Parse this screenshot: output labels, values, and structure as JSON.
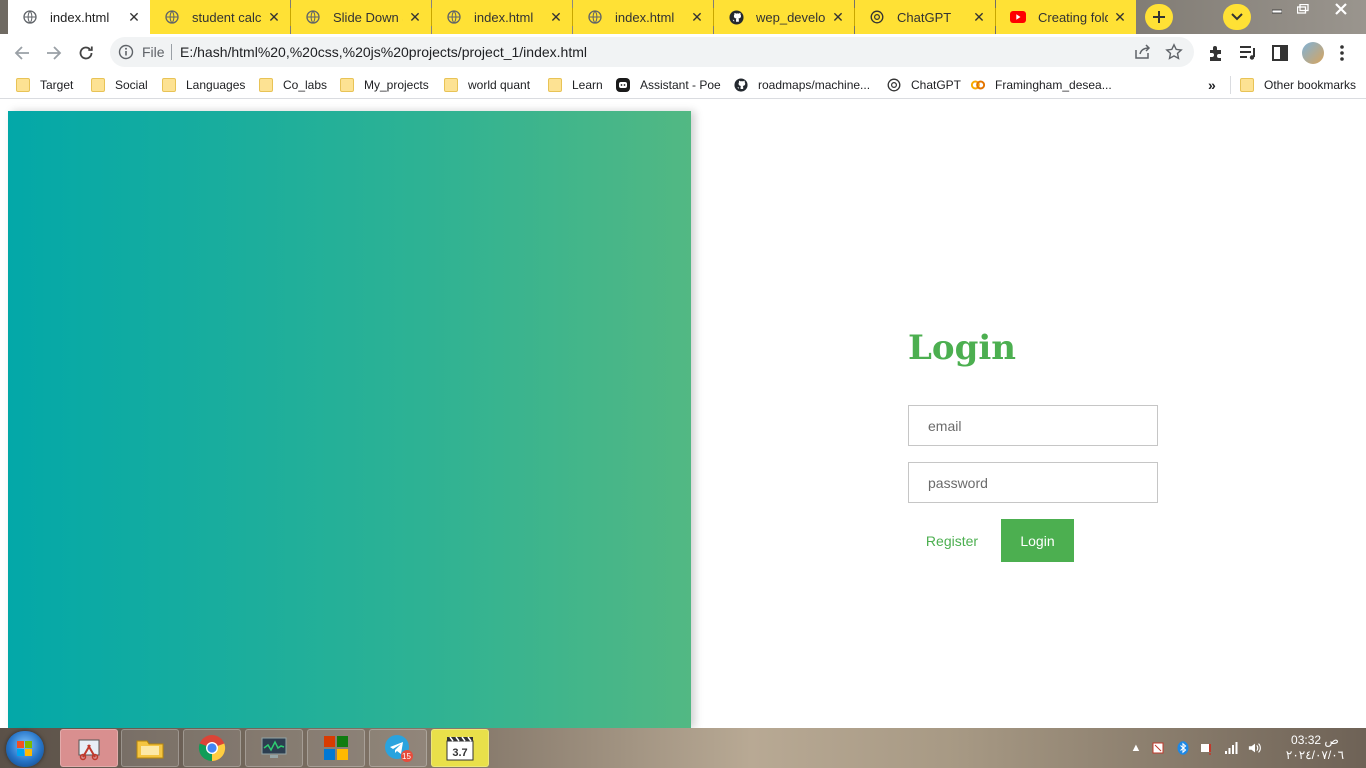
{
  "browser": {
    "tabs": [
      {
        "title": "index.html",
        "icon": "globe-icon",
        "active": true
      },
      {
        "title": "student calcul",
        "icon": "globe-icon",
        "active": false
      },
      {
        "title": "Slide Down a",
        "icon": "globe-icon",
        "active": false
      },
      {
        "title": "index.html",
        "icon": "globe-icon",
        "active": false
      },
      {
        "title": "index.html",
        "icon": "globe-icon",
        "active": false
      },
      {
        "title": "wep_developm",
        "icon": "github-icon",
        "active": false
      },
      {
        "title": "ChatGPT",
        "icon": "chatgpt-icon",
        "active": false
      },
      {
        "title": "Creating folde",
        "icon": "youtube-icon",
        "active": false
      }
    ],
    "toolbar": {
      "scheme_label": "File",
      "url": "E:/hash/html%20,%20css,%20js%20projects/project_1/index.html"
    },
    "bookmarks": [
      {
        "label": "Target",
        "icon": "folder-icon"
      },
      {
        "label": "Social",
        "icon": "folder-icon"
      },
      {
        "label": "Languages",
        "icon": "folder-icon"
      },
      {
        "label": "Co_labs",
        "icon": "folder-icon"
      },
      {
        "label": "My_projects",
        "icon": "folder-icon"
      },
      {
        "label": "world quant",
        "icon": "folder-icon"
      },
      {
        "label": "Learn",
        "icon": "folder-icon"
      },
      {
        "label": "Assistant - Poe",
        "icon": "poe-icon"
      },
      {
        "label": "roadmaps/machine...",
        "icon": "github-icon"
      },
      {
        "label": "ChatGPT",
        "icon": "chatgpt-icon"
      },
      {
        "label": "Framingham_desea...",
        "icon": "colab-icon"
      }
    ],
    "bookmarks_overflow": "»",
    "other_bookmarks": "Other bookmarks"
  },
  "page": {
    "login_title": "Login",
    "email_placeholder": "email",
    "password_placeholder": "password",
    "register_label": "Register",
    "login_button_label": "Login",
    "colors": {
      "accent": "#4caf50",
      "hero_start": "#03a8a8",
      "hero_end": "#52b883"
    }
  },
  "taskbar": {
    "apps": [
      {
        "icon": "snipping-tool-icon"
      },
      {
        "icon": "file-explorer-icon"
      },
      {
        "icon": "chrome-icon"
      },
      {
        "icon": "task-manager-icon"
      },
      {
        "icon": "office-icon"
      },
      {
        "icon": "telegram-icon",
        "badge": "15"
      },
      {
        "icon": "media-player-icon"
      }
    ],
    "clock_time": "03:32 ص",
    "clock_date": "٢٠٢٤/٠٧/٠٦"
  }
}
